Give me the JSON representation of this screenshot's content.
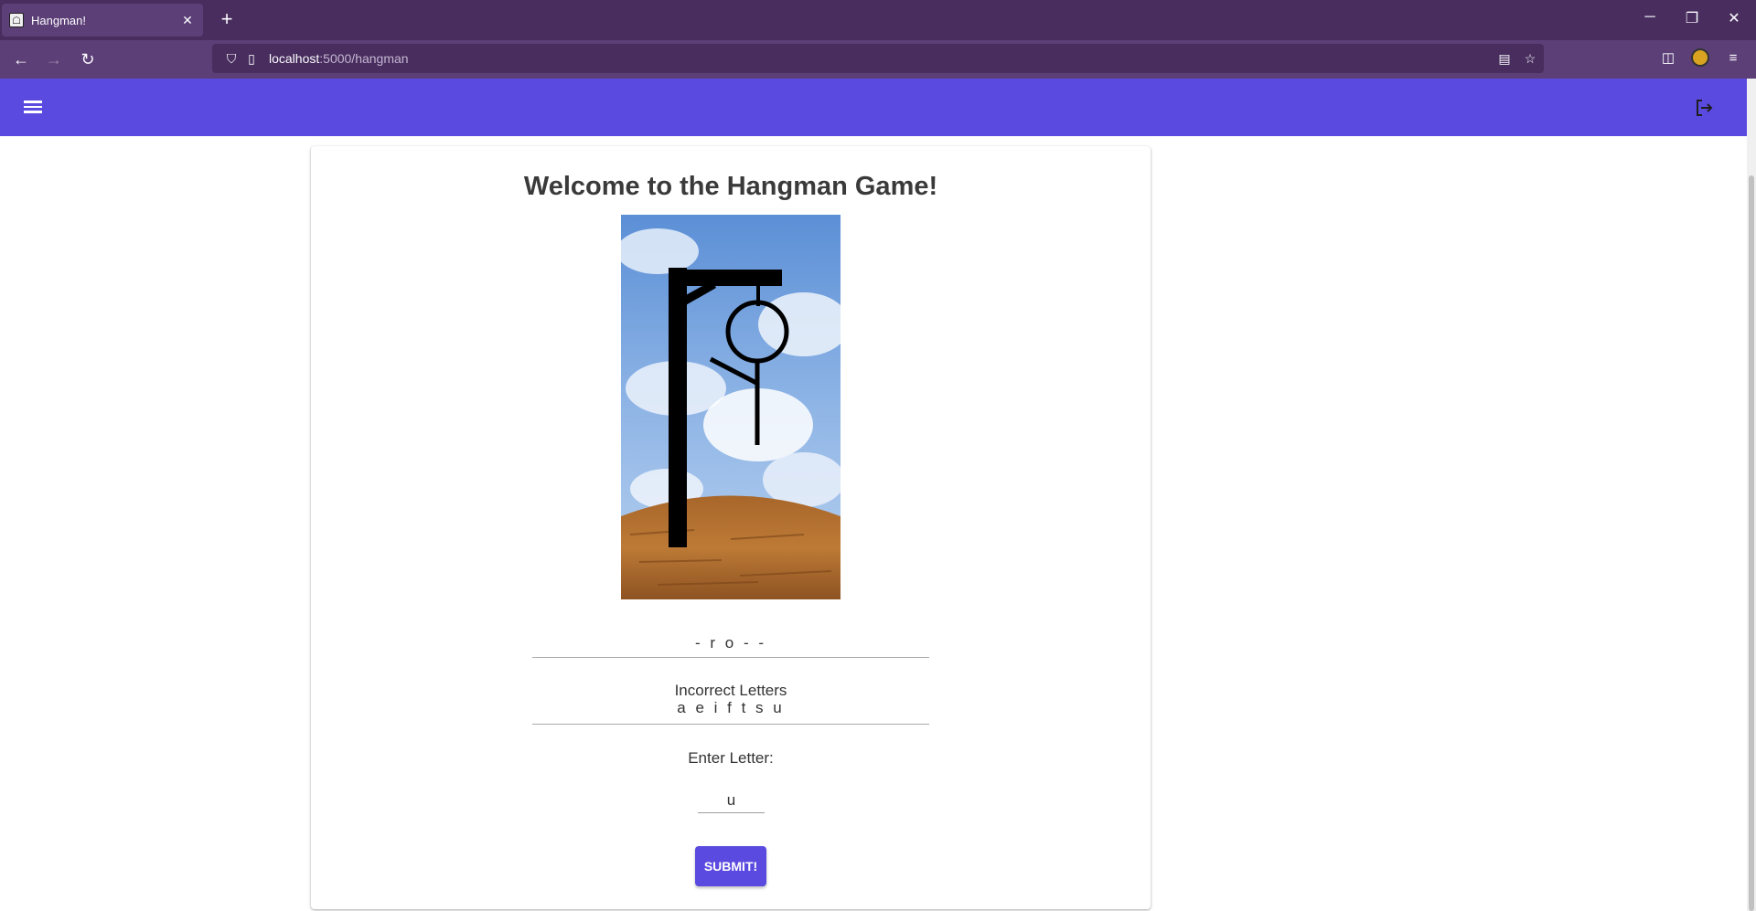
{
  "browser": {
    "tab_title": "Hangman!",
    "tab_close_glyph": "✕",
    "new_tab_glyph": "+",
    "url_host": "localhost",
    "url_path": ":5000/hangman",
    "minimize_glyph": "─",
    "restore_glyph": "❐",
    "close_glyph": "✕",
    "back_glyph": "←",
    "forward_glyph": "→",
    "reload_glyph": "↻"
  },
  "app": {
    "accent_color": "#5b4ae0",
    "menu_icon": "hamburger-icon",
    "logout_icon": "logout-icon"
  },
  "game": {
    "title": "Welcome to the Hangman Game!",
    "word_pattern": "- r o - -",
    "incorrect_label": "Incorrect Letters",
    "incorrect_letters": "a e i f t s u",
    "enter_label": "Enter Letter:",
    "letter_value": "u",
    "submit_label": "SUBMIT!",
    "hangman_parts_shown": [
      "head",
      "body",
      "left-arm"
    ]
  }
}
